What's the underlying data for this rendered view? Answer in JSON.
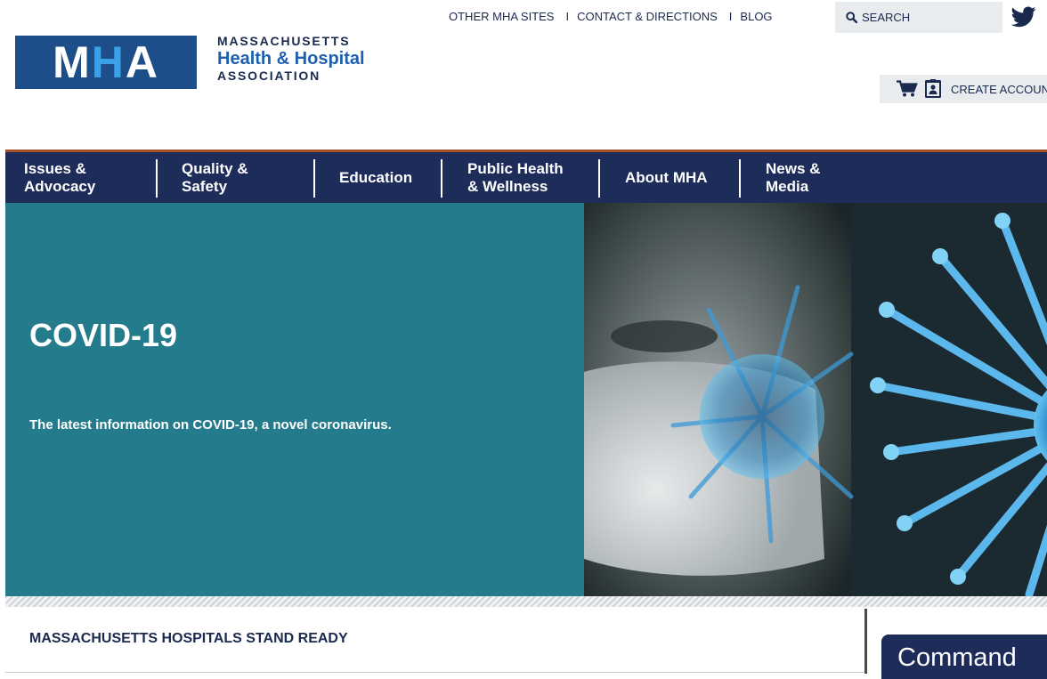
{
  "header": {
    "logo_text": "MHA",
    "org_line1": "MASSACHUSETTS",
    "org_line2": "Health & Hospital",
    "org_line3": "ASSOCIATION"
  },
  "utility_nav": {
    "items": [
      {
        "label": "OTHER MHA SITES"
      },
      {
        "label": "CONTACT & DIRECTIONS"
      },
      {
        "label": "BLOG"
      }
    ],
    "separator": "I"
  },
  "search": {
    "label": "SEARCH",
    "icon": "search-icon"
  },
  "social": {
    "icon": "twitter-icon",
    "color": "#1a2a4f"
  },
  "account": {
    "label": "CREATE ACCOUNT",
    "cart_icon": "cart-icon",
    "profile_icon": "id-card-icon"
  },
  "main_nav": {
    "items": [
      {
        "label": "Issues &\nAdvocacy"
      },
      {
        "label": "Quality &\nSafety"
      },
      {
        "label": "Education"
      },
      {
        "label": "Public Health\n& Wellness"
      },
      {
        "label": "About MHA"
      },
      {
        "label": "News &\nMedia"
      }
    ]
  },
  "hero": {
    "title": "COVID-19",
    "subtitle": "The latest information on COVID-19, a novel coronavirus.",
    "image_alt": "coronavirus-illustration"
  },
  "main": {
    "section_title": "MASSACHUSETTS HOSPITALS STAND READY"
  },
  "sidebar": {
    "box_title": "Command"
  },
  "colors": {
    "nav_bg": "#1e2c5a",
    "nav_accent": "#a5532b",
    "hero_teal": "#237b8c",
    "brand_blue": "#1d4e89",
    "text_navy": "#1a2a4f"
  }
}
